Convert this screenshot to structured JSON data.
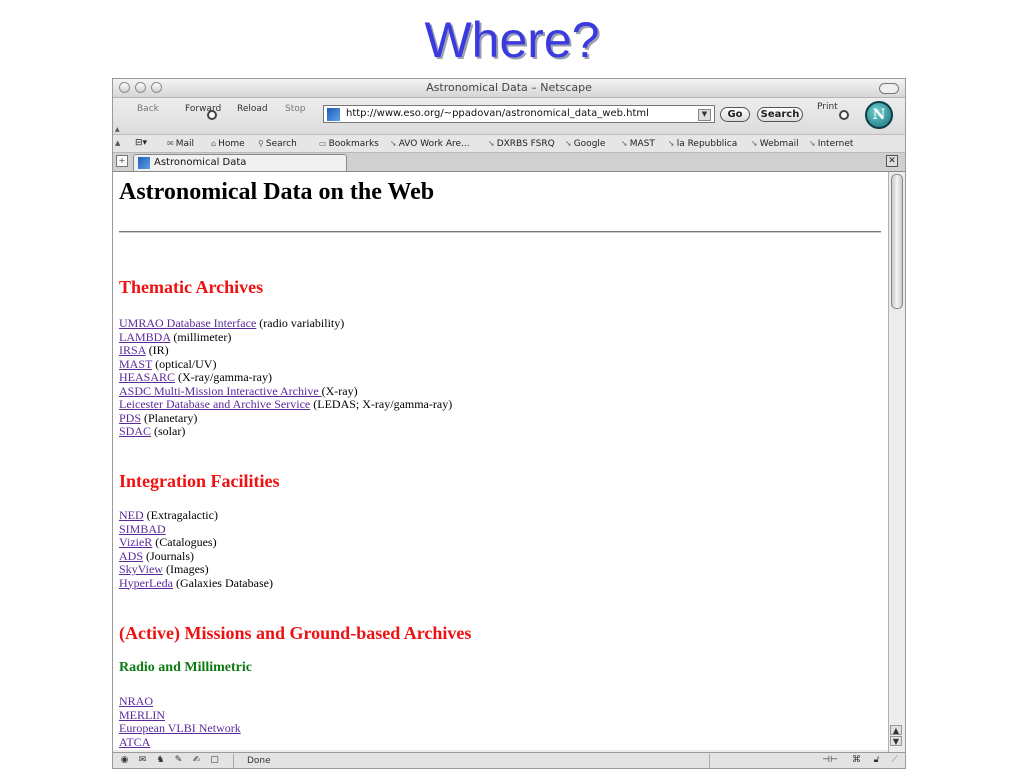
{
  "slide": {
    "title": "Where?"
  },
  "window": {
    "title": "Astronomical Data – Netscape"
  },
  "navbar": {
    "back": "Back",
    "forward": "Forward",
    "reload": "Reload",
    "stop": "Stop",
    "url": "http://www.eso.org/~ppadovan/astronomical_data_web.html",
    "go": "Go",
    "search": "Search",
    "print": "Print"
  },
  "bookmarks": {
    "items": [
      {
        "label": "Mail",
        "icon": "mail-icon"
      },
      {
        "label": "Home",
        "icon": "home-icon"
      },
      {
        "label": "Search",
        "icon": "search-icon"
      },
      {
        "label": "Bookmarks",
        "icon": "folder-icon"
      },
      {
        "label": "AVO Work Are...",
        "icon": "bookmark-icon"
      },
      {
        "label": "DXRBS FSRQ",
        "icon": "bookmark-icon"
      },
      {
        "label": "Google",
        "icon": "bookmark-icon"
      },
      {
        "label": "MAST",
        "icon": "bookmark-icon"
      },
      {
        "label": "la Repubblica",
        "icon": "bookmark-icon"
      },
      {
        "label": "Webmail",
        "icon": "bookmark-icon"
      },
      {
        "label": "Internet",
        "icon": "bookmark-icon"
      }
    ]
  },
  "tab": {
    "label": "Astronomical Data"
  },
  "page": {
    "heading": "Astronomical Data on the Web",
    "sections": {
      "thematic": {
        "title": "Thematic Archives",
        "items": [
          {
            "link": "UMRAO Database Interface",
            "note": " (radio variability)"
          },
          {
            "link": "LAMBDA",
            "note": " (millimeter)"
          },
          {
            "link": "IRSA",
            "note": " (IR)"
          },
          {
            "link": "MAST",
            "note": " (optical/UV)"
          },
          {
            "link": "HEASARC",
            "note": " (X-ray/gamma-ray)"
          },
          {
            "link": "ASDC Multi-Mission Interactive Archive ",
            "note": "(X-ray)"
          },
          {
            "link": "Leicester Database and Archive Service",
            "note": " (LEDAS; X-ray/gamma-ray)"
          },
          {
            "link": "PDS",
            "note": " (Planetary)"
          },
          {
            "link": "SDAC",
            "note": " (solar)"
          }
        ]
      },
      "integration": {
        "title": "Integration Facilities",
        "items": [
          {
            "link": "NED",
            "note": " (Extragalactic)"
          },
          {
            "link": "SIMBAD",
            "note": ""
          },
          {
            "link": "VizieR",
            "note": " (Catalogues)"
          },
          {
            "link": "ADS",
            "note": " (Journals)"
          },
          {
            "link": "SkyView",
            "note": " (Images)"
          },
          {
            "link": "HyperLeda",
            "note": " (Galaxies Database)"
          }
        ]
      },
      "missions": {
        "title": "(Active) Missions and Ground-based Archives",
        "subtitle": "Radio and Millimetric",
        "items": [
          {
            "link": "NRAO ",
            "note": ""
          },
          {
            "link": "MERLIN",
            "note": ""
          },
          {
            "link": "European VLBI Network",
            "note": ""
          },
          {
            "link": "ATCA",
            "note": ""
          }
        ]
      }
    }
  },
  "status": {
    "text": "Done"
  }
}
